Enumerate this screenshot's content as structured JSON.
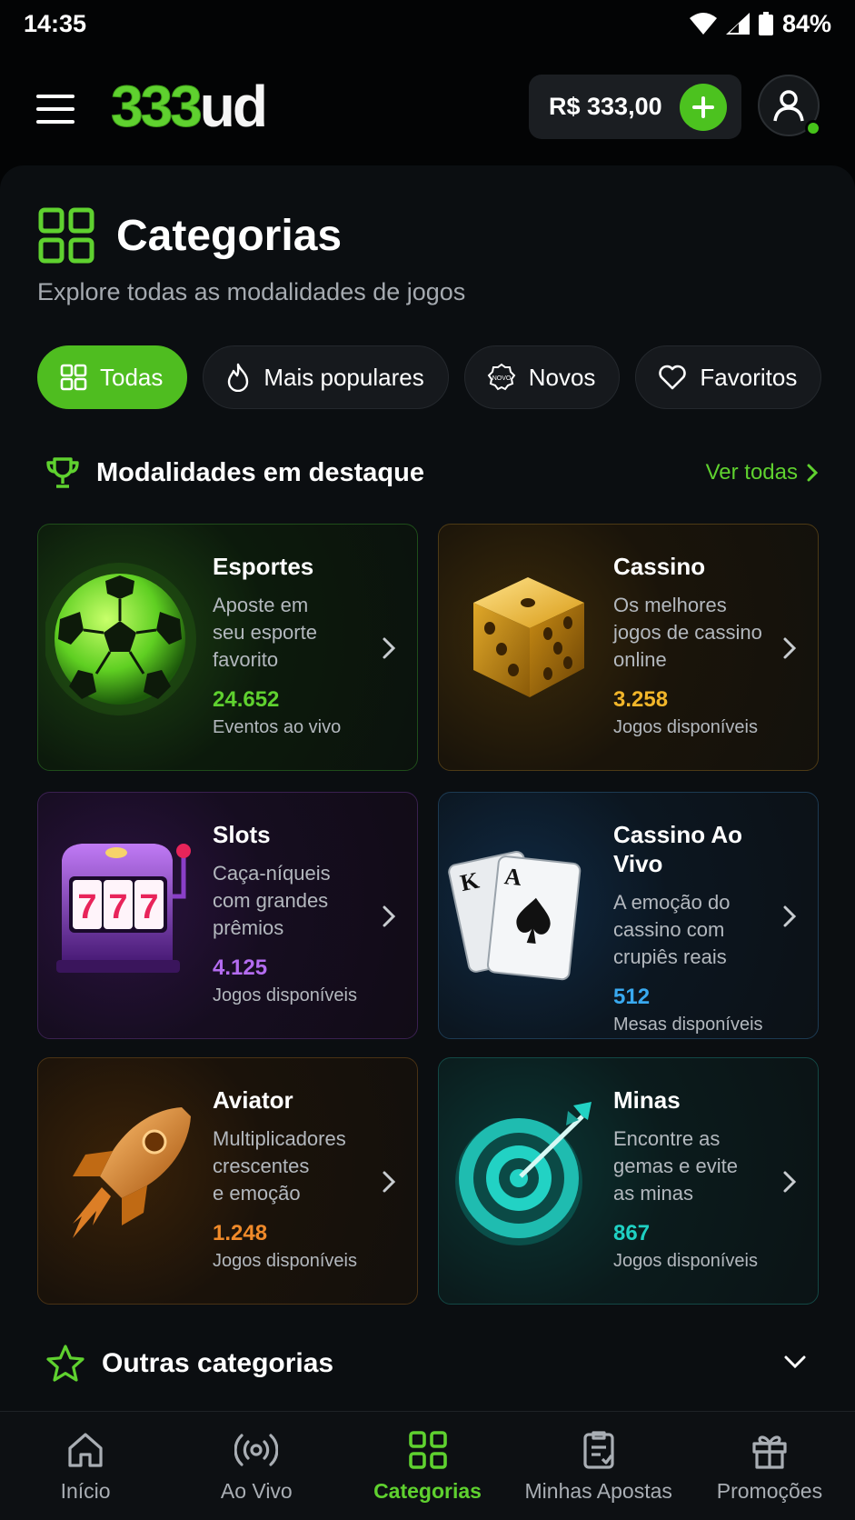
{
  "status_bar": {
    "time": "14:35",
    "battery": "84%"
  },
  "header": {
    "logo_number": "333",
    "logo_suffix": "ud",
    "balance": "R$ 333,00"
  },
  "page": {
    "title": "Categorias",
    "subtitle": "Explore todas as modalidades de jogos"
  },
  "filters": [
    {
      "label": "Todas",
      "icon": "grid-icon",
      "active": true
    },
    {
      "label": "Mais populares",
      "icon": "flame-icon",
      "active": false
    },
    {
      "label": "Novos",
      "icon": "new-badge-icon",
      "badge_text": "NOVO",
      "active": false
    },
    {
      "label": "Favoritos",
      "icon": "heart-icon",
      "active": false
    }
  ],
  "featured": {
    "title": "Modalidades em destaque",
    "see_all": "Ver todas",
    "cards": [
      {
        "title": "Esportes",
        "description": "Aposte em\nseu esporte\nfavorito",
        "count": "24.652",
        "count_label": "Eventos ao vivo",
        "accent": "#5fd12f",
        "icon": "soccer-ball-icon"
      },
      {
        "title": "Cassino",
        "description": "Os melhores\njogos de cassino\nonline",
        "count": "3.258",
        "count_label": "Jogos disponíveis",
        "accent": "#f2b62a",
        "icon": "dice-icon"
      },
      {
        "title": "Slots",
        "description": "Caça-níqueis\ncom grandes\nprêmios",
        "count": "4.125",
        "count_label": "Jogos disponíveis",
        "accent": "#b46cf0",
        "icon": "slot-machine-icon",
        "art_text": "777"
      },
      {
        "title": "Cassino Ao Vivo",
        "description": "A emoção do\ncassino com\ncrupiês reais",
        "count": "512",
        "count_label": "Mesas disponíveis",
        "accent": "#39a9f0",
        "icon": "playing-cards-icon",
        "art_text": [
          "K",
          "A"
        ]
      },
      {
        "title": "Aviator",
        "description": "Multiplicadores\ncrescentes\ne emoção",
        "count": "1.248",
        "count_label": "Jogos disponíveis",
        "accent": "#f08a2a",
        "icon": "rocket-icon"
      },
      {
        "title": "Minas",
        "description": "Encontre as\ngemas e evite\nas minas",
        "count": "867",
        "count_label": "Jogos disponíveis",
        "accent": "#1fd1c3",
        "icon": "target-icon"
      }
    ]
  },
  "other": {
    "title": "Outras categorias"
  },
  "bottom_nav": [
    {
      "label": "Início",
      "icon": "home-icon",
      "active": false
    },
    {
      "label": "Ao Vivo",
      "icon": "live-broadcast-icon",
      "active": false
    },
    {
      "label": "Categorias",
      "icon": "grid-icon",
      "active": true
    },
    {
      "label": "Minhas Apostas",
      "icon": "bet-slip-icon",
      "active": false
    },
    {
      "label": "Promoções",
      "icon": "gift-icon",
      "active": false
    }
  ],
  "colors": {
    "brand_green": "#5fd12f",
    "background": "#0b0e11"
  }
}
